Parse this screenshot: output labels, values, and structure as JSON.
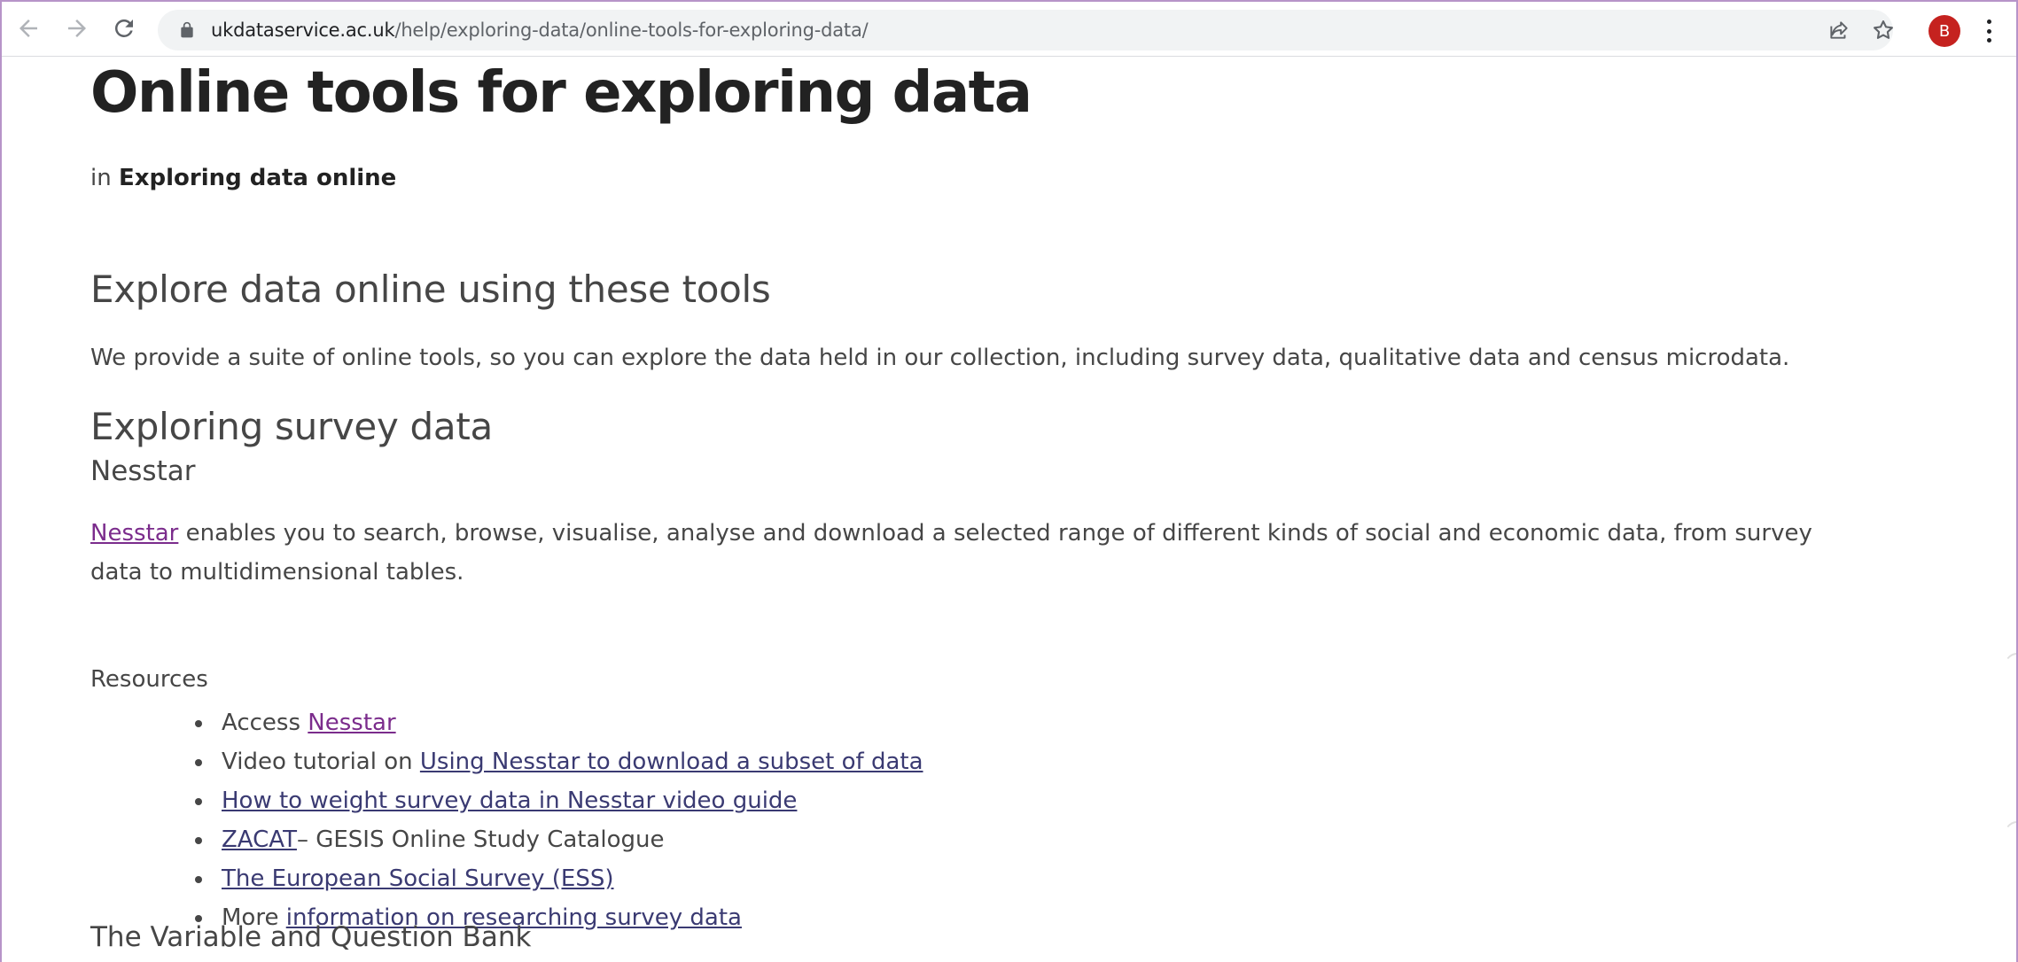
{
  "browser": {
    "url_host": "ukdataservice.ac.uk",
    "url_path": "/help/exploring-data/online-tools-for-exploring-data/",
    "profile_initial": "B"
  },
  "page": {
    "title": "Online tools for exploring data",
    "in_prefix": "in",
    "in_section": "Exploring data online",
    "explore_heading": "Explore data online using these tools",
    "intro": "We provide a suite of online tools, so you can explore the data held in our collection, including survey data, qualitative data and census microdata.",
    "survey_heading": "Exploring survey data",
    "nesstar_heading": "Nesstar",
    "nesstar_link": "Nesstar",
    "nesstar_desc": " enables you to search, browse, visualise, analyse and download a selected range of different kinds of social and economic data, from survey data to multidimensional tables.",
    "resources_label": "Resources",
    "resources": [
      {
        "prefix": "Access ",
        "link": "Nesstar",
        "suffix": ""
      },
      {
        "prefix": "Video tutorial on ",
        "link": "Using Nesstar to download a subset of data",
        "suffix": ""
      },
      {
        "prefix": "",
        "link": "How to weight survey data in Nesstar video guide",
        "suffix": ""
      },
      {
        "prefix": "",
        "link": "ZACAT",
        "suffix": "– GESIS Online Study Catalogue"
      },
      {
        "prefix": "",
        "link": "The European Social Survey (ESS)",
        "suffix": ""
      },
      {
        "prefix": "More ",
        "link": "information on researching survey data",
        "suffix": ""
      }
    ],
    "vqb_heading": "The Variable and Question Bank"
  },
  "colors": {
    "link_visited": "#7b2c8c",
    "link": "#3a3a72",
    "text": "#464646",
    "avatar": "#c5221f"
  }
}
